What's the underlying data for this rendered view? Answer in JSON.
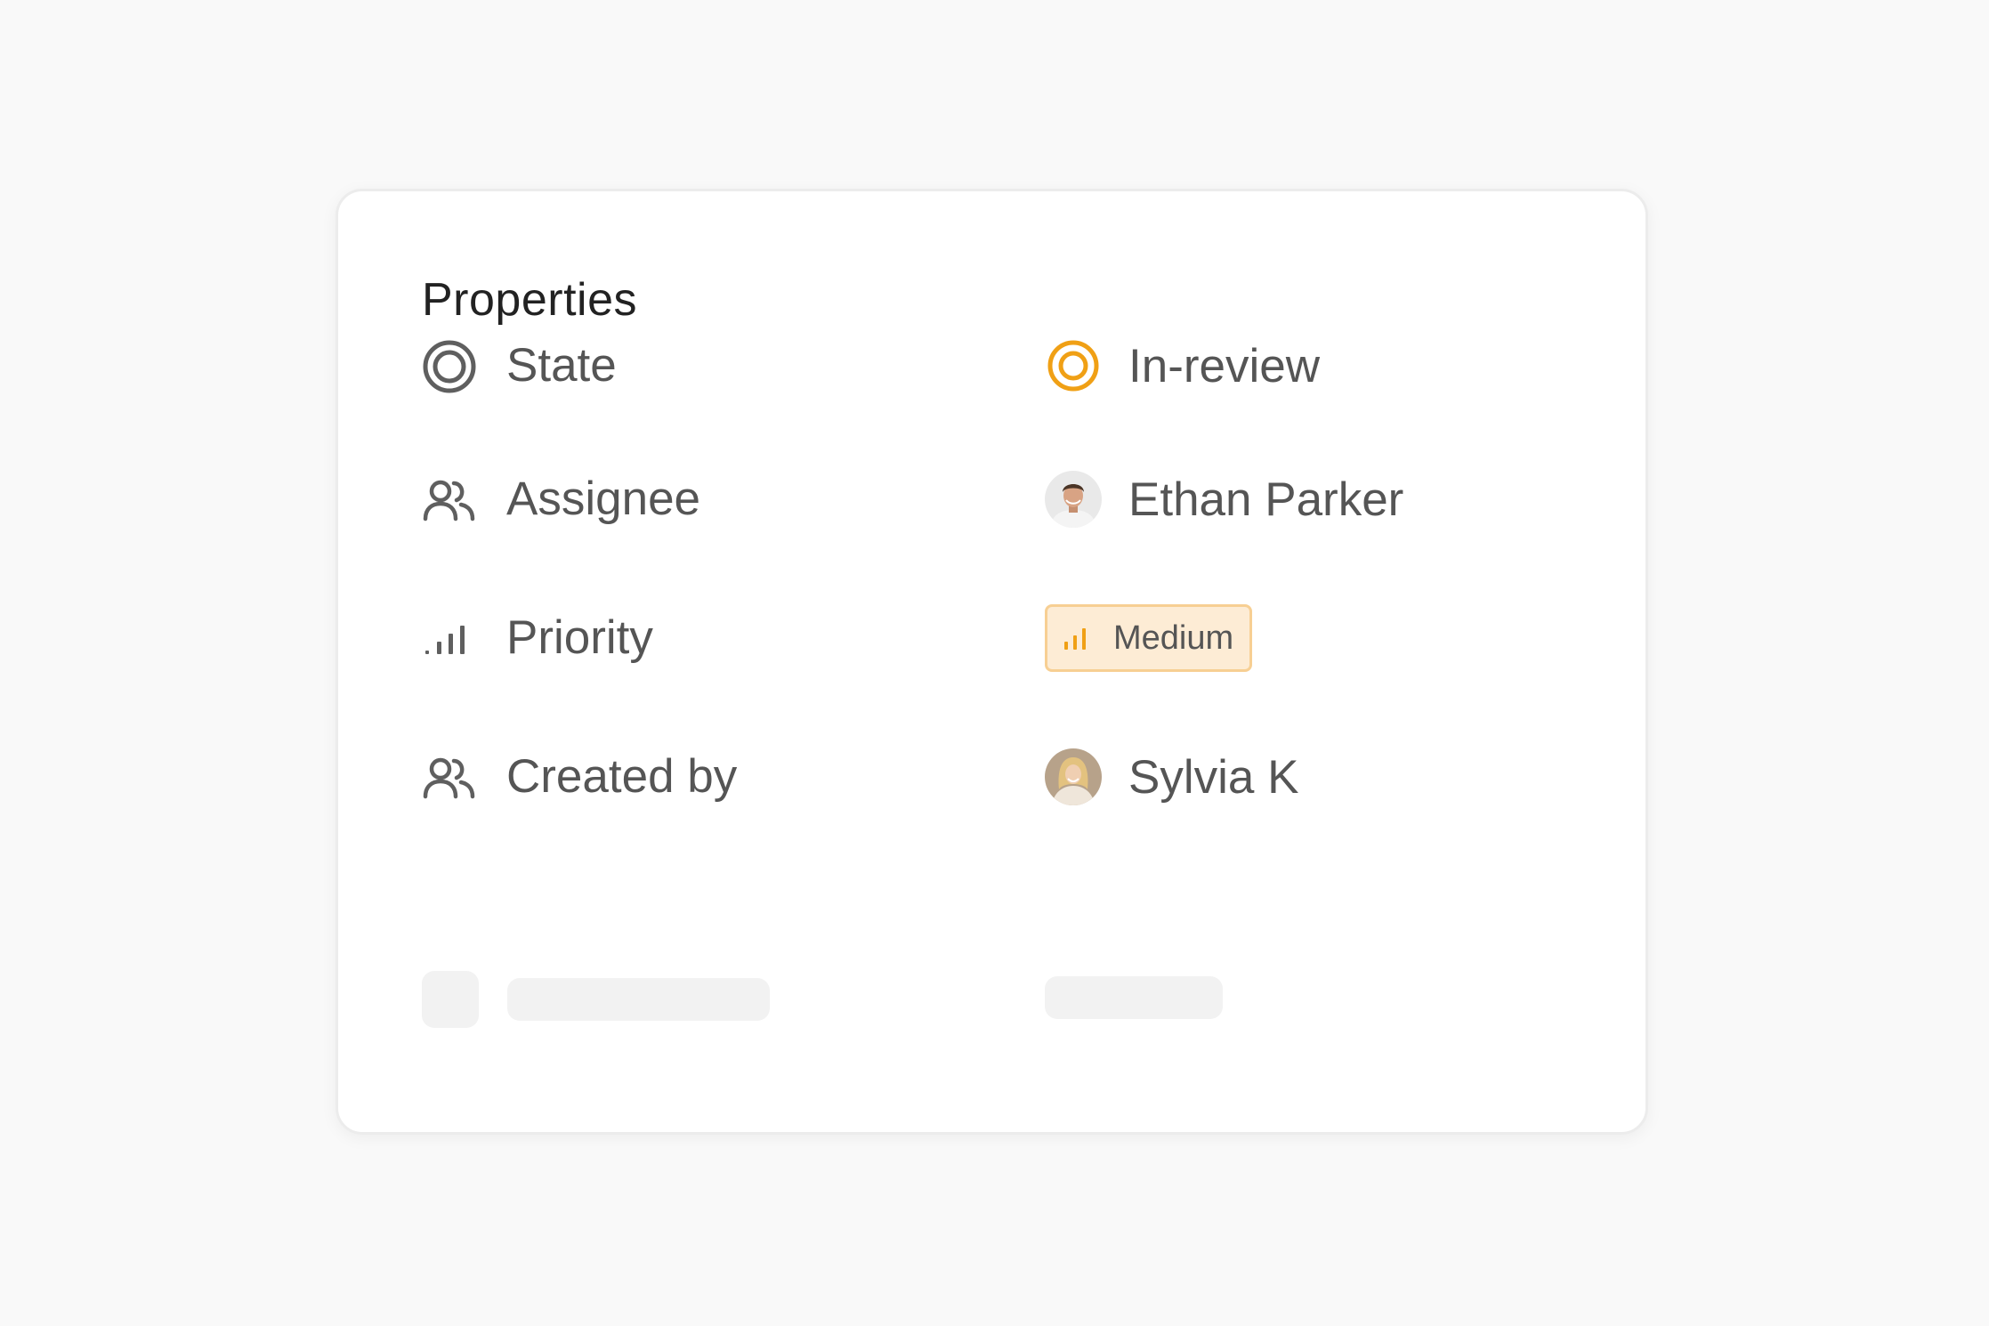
{
  "panel": {
    "title": "Properties",
    "accent_color": "#f0a015",
    "properties": [
      {
        "label": "State",
        "icon": "state-circle-icon",
        "value": "In-review",
        "value_icon": "in-review-status-icon"
      },
      {
        "label": "Assignee",
        "icon": "users-icon",
        "value": "Ethan Parker",
        "value_icon": "avatar-ethan-parker"
      },
      {
        "label": "Priority",
        "icon": "priority-bars-icon",
        "value": "Medium",
        "value_icon": "medium-priority-bars-icon",
        "badge_bg": "#fdecd5",
        "badge_border": "#f7cf93"
      },
      {
        "label": "Created by",
        "icon": "users-icon",
        "value": "Sylvia K",
        "value_icon": "avatar-sylvia-k"
      }
    ]
  }
}
